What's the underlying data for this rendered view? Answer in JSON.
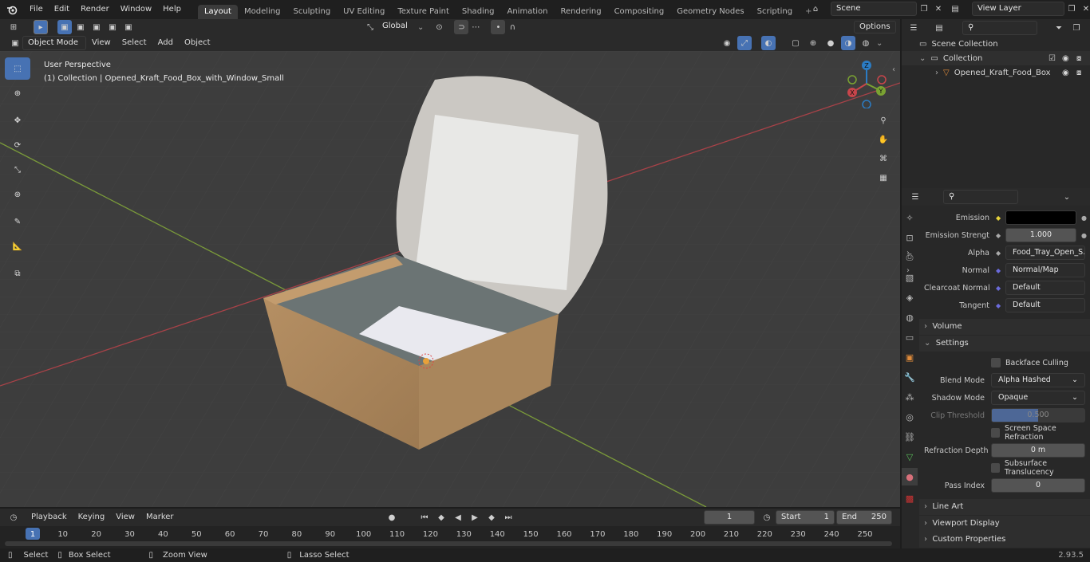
{
  "menubar": {
    "items": [
      "File",
      "Edit",
      "Render",
      "Window",
      "Help"
    ],
    "workspaces": [
      "Layout",
      "Modeling",
      "Sculpting",
      "UV Editing",
      "Texture Paint",
      "Shading",
      "Animation",
      "Rendering",
      "Compositing",
      "Geometry Nodes",
      "Scripting"
    ],
    "active_workspace": "Layout",
    "scene": "Scene",
    "view_layer": "View Layer"
  },
  "tool_header": {
    "orientation": "Global",
    "options": "Options"
  },
  "viewport_header": {
    "mode": "Object Mode",
    "menus": [
      "View",
      "Select",
      "Add",
      "Object"
    ]
  },
  "viewport": {
    "perspective": "User Perspective",
    "collection_info": "(1) Collection | Opened_Kraft_Food_Box_with_Window_Small",
    "gizmo": {
      "z": "Z",
      "x": "X",
      "y": "Y"
    }
  },
  "outliner": {
    "scene_collection": "Scene Collection",
    "collection": "Collection",
    "object": "Opened_Kraft_Food_Box"
  },
  "properties": {
    "emission_label": "Emission",
    "emission_strength_label": "Emission Strengt",
    "emission_strength_value": "1.000",
    "alpha_label": "Alpha",
    "alpha_value": "Food_Tray_Open_S...",
    "normal_label": "Normal",
    "normal_value": "Normal/Map",
    "clearcoat_label": "Clearcoat Normal",
    "clearcoat_value": "Default",
    "tangent_label": "Tangent",
    "tangent_value": "Default",
    "volume": "Volume",
    "settings": "Settings",
    "backface_culling": "Backface Culling",
    "blend_mode_label": "Blend Mode",
    "blend_mode_value": "Alpha Hashed",
    "shadow_mode_label": "Shadow Mode",
    "shadow_mode_value": "Opaque",
    "clip_threshold_label": "Clip Threshold",
    "clip_threshold_value": "0.500",
    "ssr_label": "Screen Space Refraction",
    "refraction_depth_label": "Refraction Depth",
    "refraction_depth_value": "0 m",
    "subsurface_label": "Subsurface Translucency",
    "pass_index_label": "Pass Index",
    "pass_index_value": "0",
    "line_art": "Line Art",
    "viewport_display": "Viewport Display",
    "custom_properties": "Custom Properties"
  },
  "timeline": {
    "menus": [
      "Playback",
      "Keying",
      "View",
      "Marker"
    ],
    "current_frame": "1",
    "start_label": "Start",
    "start_value": "1",
    "end_label": "End",
    "end_value": "250",
    "ticks": [
      "1",
      "10",
      "20",
      "30",
      "40",
      "50",
      "60",
      "70",
      "80",
      "90",
      "100",
      "110",
      "120",
      "130",
      "140",
      "150",
      "160",
      "170",
      "180",
      "190",
      "200",
      "210",
      "220",
      "230",
      "240",
      "250"
    ]
  },
  "statusbar": {
    "select": "Select",
    "box_select": "Box Select",
    "zoom_view": "Zoom View",
    "lasso_select": "Lasso Select",
    "version": "2.93.5"
  },
  "colors": {
    "accent": "#4772b3",
    "viewport_bg": "#3d3d3d",
    "x_axis": "#c8454b",
    "y_axis": "#7aa232",
    "z_axis": "#2b7cc4"
  }
}
